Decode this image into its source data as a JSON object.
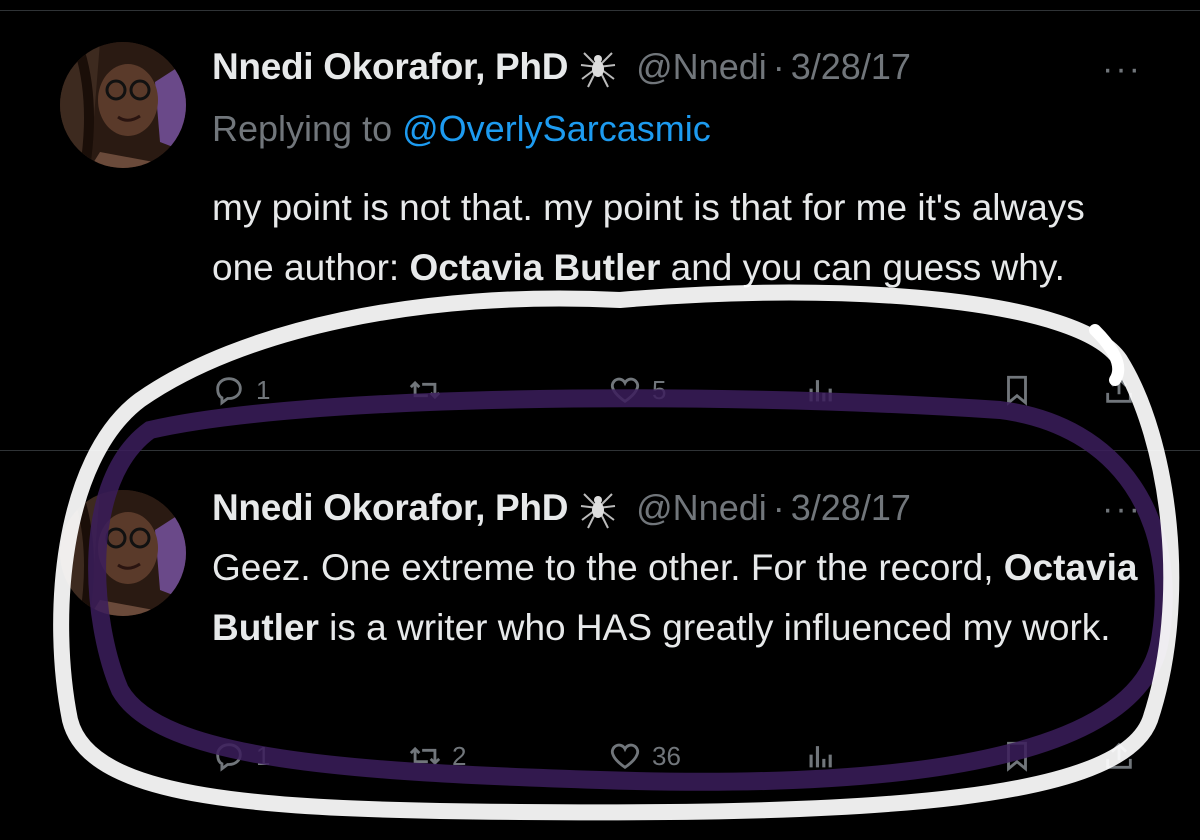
{
  "tweets": [
    {
      "author_name": "Nnedi Okorafor, PhD",
      "author_handle": "@Nnedi",
      "separator": "·",
      "date": "3/28/17",
      "more_label": "···",
      "replying_prefix": "Replying to",
      "replying_to": "@OverlySarcasmic",
      "body_parts": {
        "p1": "my point is not that. my point is that for me it's always one author: ",
        "b1": "Octavia Butler",
        "p2": " and you can guess why."
      },
      "counts": {
        "replies": "1",
        "retweets": "",
        "likes": "5"
      }
    },
    {
      "author_name": "Nnedi Okorafor, PhD",
      "author_handle": "@Nnedi",
      "separator": "·",
      "date": "3/28/17",
      "more_label": "···",
      "body_parts": {
        "p1": "Geez. One extreme to the other. For the record, ",
        "b1": "Octavia Butler",
        "p2": " is a writer who HAS greatly influenced my work."
      },
      "counts": {
        "replies": "1",
        "retweets": "2",
        "likes": "36"
      }
    }
  ],
  "icons": {
    "reply": "reply-icon",
    "retweet": "retweet-icon",
    "like": "heart-icon",
    "views": "views-icon",
    "bookmark": "bookmark-icon",
    "share": "share-icon",
    "badge": "spider-icon"
  },
  "colors": {
    "background": "#000000",
    "text": "#e7e9ea",
    "muted": "#71767b",
    "link": "#1d9bf0",
    "highlight_white": "#ffffff",
    "highlight_purple": "#3b1d5c"
  }
}
